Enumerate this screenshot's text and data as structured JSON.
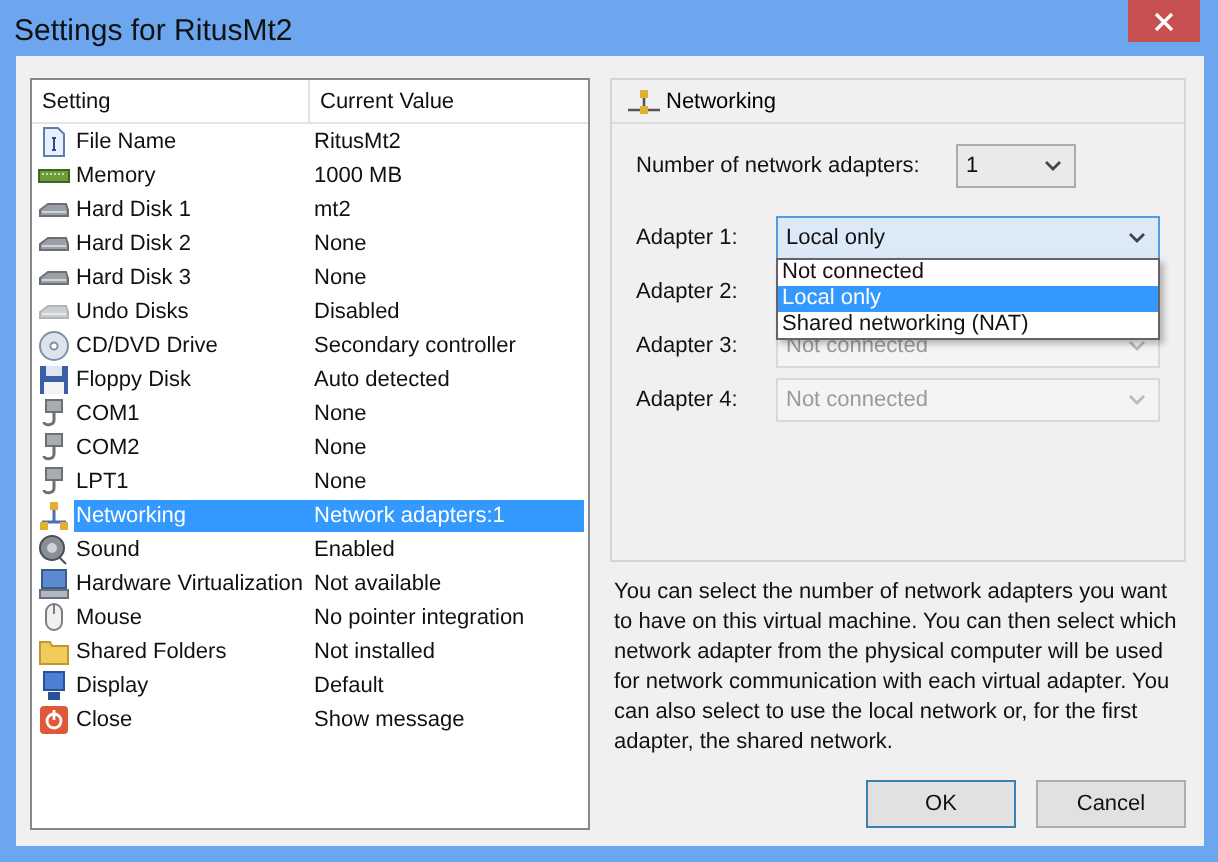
{
  "window": {
    "title": "Settings for RitusMt2"
  },
  "settings": {
    "columns": [
      "Setting",
      "Current Value"
    ],
    "rows": [
      {
        "name": "File Name",
        "value": "RitusMt2",
        "selected": false
      },
      {
        "name": "Memory",
        "value": "1000 MB",
        "selected": false
      },
      {
        "name": "Hard Disk 1",
        "value": "mt2",
        "selected": false
      },
      {
        "name": "Hard Disk 2",
        "value": "None",
        "selected": false
      },
      {
        "name": "Hard Disk 3",
        "value": "None",
        "selected": false
      },
      {
        "name": "Undo Disks",
        "value": "Disabled",
        "selected": false
      },
      {
        "name": "CD/DVD Drive",
        "value": "Secondary controller",
        "selected": false
      },
      {
        "name": "Floppy Disk",
        "value": "Auto detected",
        "selected": false
      },
      {
        "name": "COM1",
        "value": "None",
        "selected": false
      },
      {
        "name": "COM2",
        "value": "None",
        "selected": false
      },
      {
        "name": "LPT1",
        "value": "None",
        "selected": false
      },
      {
        "name": "Networking",
        "value": "Network adapters:1",
        "selected": true
      },
      {
        "name": "Sound",
        "value": "Enabled",
        "selected": false
      },
      {
        "name": "Hardware Virtualization",
        "value": "Not available",
        "selected": false
      },
      {
        "name": "Mouse",
        "value": "No pointer integration",
        "selected": false
      },
      {
        "name": "Shared Folders",
        "value": "Not installed",
        "selected": false
      },
      {
        "name": "Display",
        "value": "Default",
        "selected": false
      },
      {
        "name": "Close",
        "value": "Show message",
        "selected": false
      }
    ]
  },
  "networking": {
    "title": "Networking",
    "count_label": "Number of network adapters:",
    "count_value": "1",
    "adapters": [
      {
        "label": "Adapter 1:",
        "value": "Local only",
        "disabled": false,
        "expanded": true
      },
      {
        "label": "Adapter 2:"
      },
      {
        "label": "Adapter 3:",
        "value": "Not connected",
        "disabled": true,
        "expanded": false
      },
      {
        "label": "Adapter 4:",
        "value": "Not connected",
        "disabled": true,
        "expanded": false
      }
    ],
    "options": [
      {
        "label": "Not connected",
        "selected": false
      },
      {
        "label": "Local only",
        "selected": true
      },
      {
        "label": "Shared networking (NAT)",
        "selected": false
      }
    ]
  },
  "description": "You can select the number of network adapters you want to have on this virtual machine. You can then select which network adapter from the physical computer will be used for network communication with each virtual adapter. You can also select to use the local network or, for the first adapter, the shared network.",
  "buttons": [
    "OK",
    "Cancel"
  ]
}
